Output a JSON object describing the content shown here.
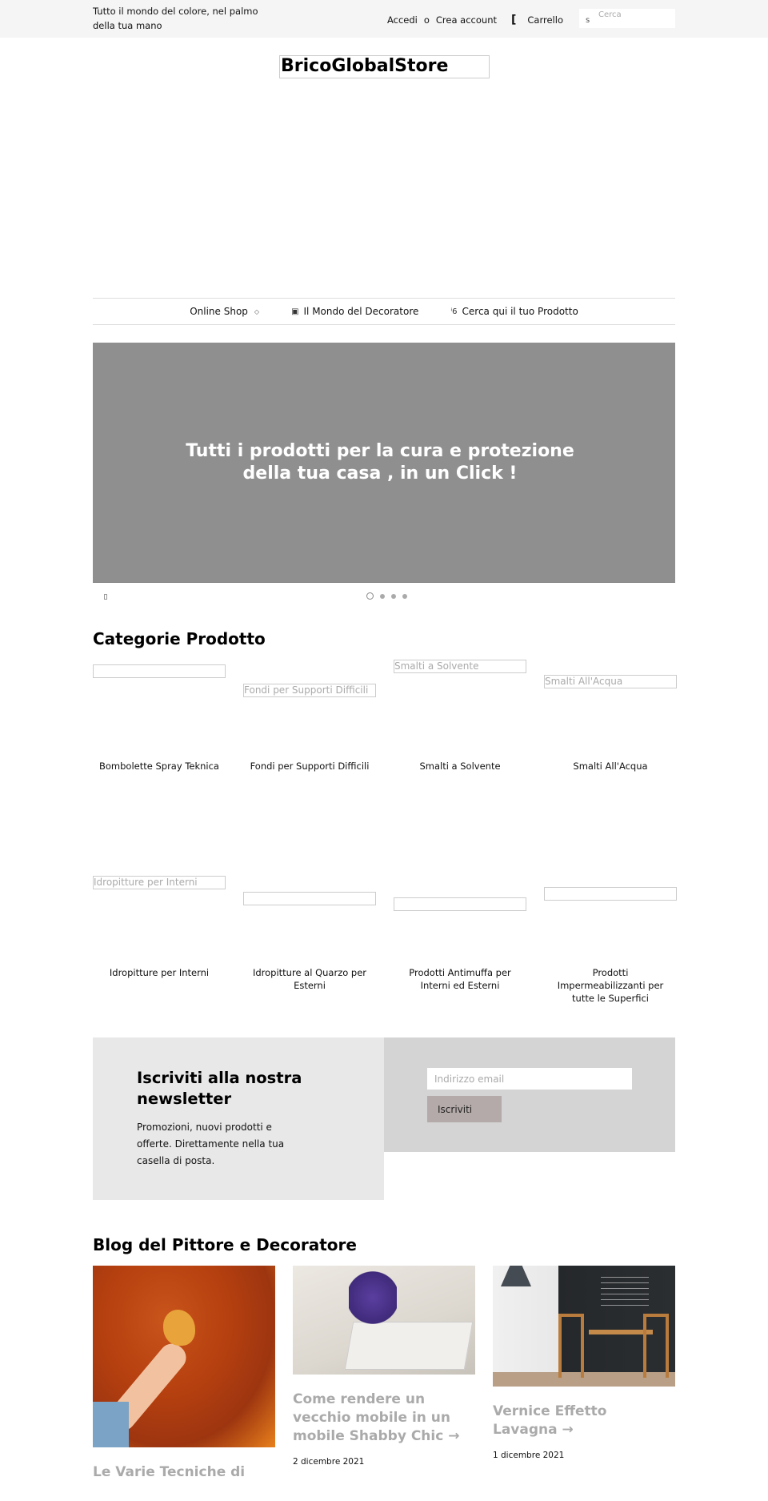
{
  "topbar": {
    "tagline": "Tutto il mondo del colore, nel palmo della tua mano",
    "login_label": "Accedi",
    "or_label": "o",
    "create_account_label": "Crea account",
    "cart_icon": "[",
    "cart_label": "Carrello",
    "search_icon": "s",
    "search_placeholder": "Cerca"
  },
  "logo": {
    "text": "BricoGlobalStore"
  },
  "nav": {
    "items": [
      {
        "label": "Online Shop",
        "icon": "",
        "has_dropdown": true,
        "chevron": "◇"
      },
      {
        "label": "Il Mondo del Decoratore",
        "icon": "▣",
        "has_dropdown": false
      },
      {
        "label": "Cerca qui il tuo Prodotto",
        "icon": "ⁱ6",
        "has_dropdown": false
      }
    ]
  },
  "hero": {
    "title": "Tutti i prodotti per la cura e protezione della tua casa , in un Click !",
    "background_color": "#8f8f8f",
    "slides_count": 4,
    "active_slide": 1
  },
  "categories": {
    "title": "Categorie Prodotto",
    "items": [
      {
        "name": "Bombolette Spray Teknica",
        "image_alt": ""
      },
      {
        "name": "Fondi per Supporti Difficili",
        "image_alt": "Fondi per Supporti Difficili"
      },
      {
        "name": "Smalti a Solvente",
        "image_alt": "Smalti a Solvente"
      },
      {
        "name": "Smalti All'Acqua",
        "image_alt": "Smalti All'Acqua"
      },
      {
        "name": "Idropitture per Interni",
        "image_alt": "Idropitture per Interni"
      },
      {
        "name": "Idropitture al Quarzo per Esterni",
        "image_alt": ""
      },
      {
        "name": "Prodotti Antimuffa per Interni ed Esterni",
        "image_alt": ""
      },
      {
        "name": "Prodotti Impermeabilizzanti per tutte le Superfici",
        "image_alt": ""
      }
    ]
  },
  "newsletter": {
    "title": "Iscriviti alla nostra newsletter",
    "description": "Promozioni, nuovi prodotti e offerte. Direttamente nella tua casella di posta.",
    "email_placeholder": "Indirizzo email",
    "email_value": "",
    "submit_label": "Iscriviti",
    "button_color": "#b5aaaa"
  },
  "blog": {
    "title": "Blog del Pittore e Decoratore",
    "posts": [
      {
        "title": "Le Varie Tecniche di",
        "date": "",
        "image": "orange-wall-sponge"
      },
      {
        "title": "Come rendere un vecchio mobile in un mobile Shabby Chic →",
        "date": "2 dicembre 2021",
        "image": "lavender-on-white-box"
      },
      {
        "title": "Vernice Effetto Lavagna →",
        "date": "1 dicembre 2021",
        "image": "chalkboard-dining-room"
      }
    ]
  }
}
